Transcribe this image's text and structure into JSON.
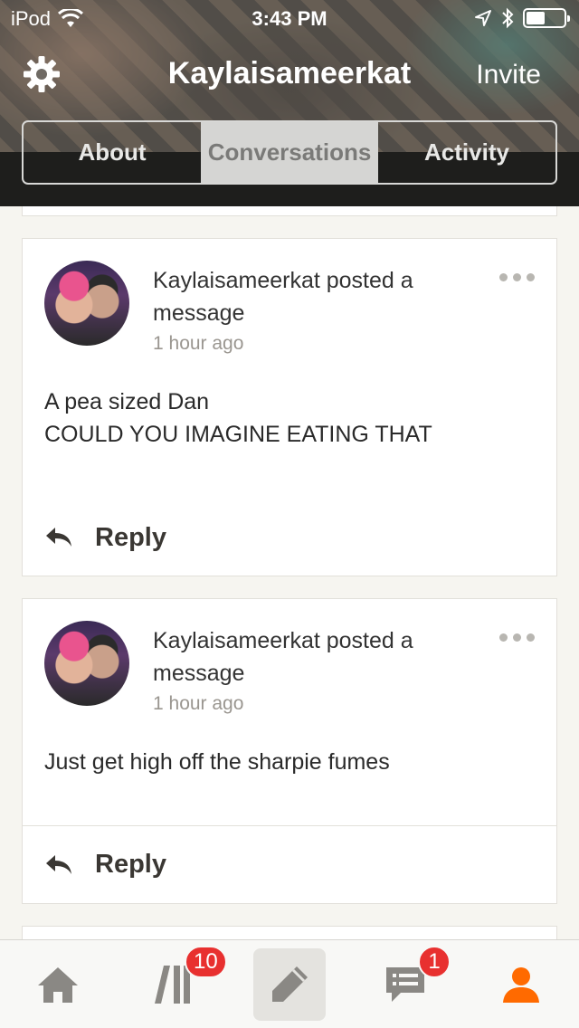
{
  "status_bar": {
    "carrier": "iPod",
    "time": "3:43 PM"
  },
  "header": {
    "title": "Kaylaisameerkat",
    "invite_label": "Invite",
    "settings_icon": "gear-icon"
  },
  "tabs": [
    {
      "label": "About",
      "active": false
    },
    {
      "label": "Conversations",
      "active": true
    },
    {
      "label": "Activity",
      "active": false
    }
  ],
  "posts": [
    {
      "author_line": "Kaylaisameerkat posted a message",
      "time": "1 hour ago",
      "body_lines": [
        "A pea sized Dan",
        "COULD YOU IMAGINE EATING THAT"
      ],
      "reply_label": "Reply"
    },
    {
      "author_line": "Kaylaisameerkat posted a message",
      "time": "1 hour ago",
      "body_lines": [
        "Just get high off the sharpie fumes"
      ],
      "reply_label": "Reply"
    }
  ],
  "tabbar": {
    "items": [
      {
        "icon": "home-icon"
      },
      {
        "icon": "library-icon",
        "badge": "10"
      },
      {
        "icon": "compose-icon"
      },
      {
        "icon": "messages-icon",
        "badge": "1"
      },
      {
        "icon": "profile-icon"
      }
    ],
    "accent_color": "#ff6a00",
    "inactive_color": "#8a8884",
    "badge_color": "#e8302f"
  }
}
